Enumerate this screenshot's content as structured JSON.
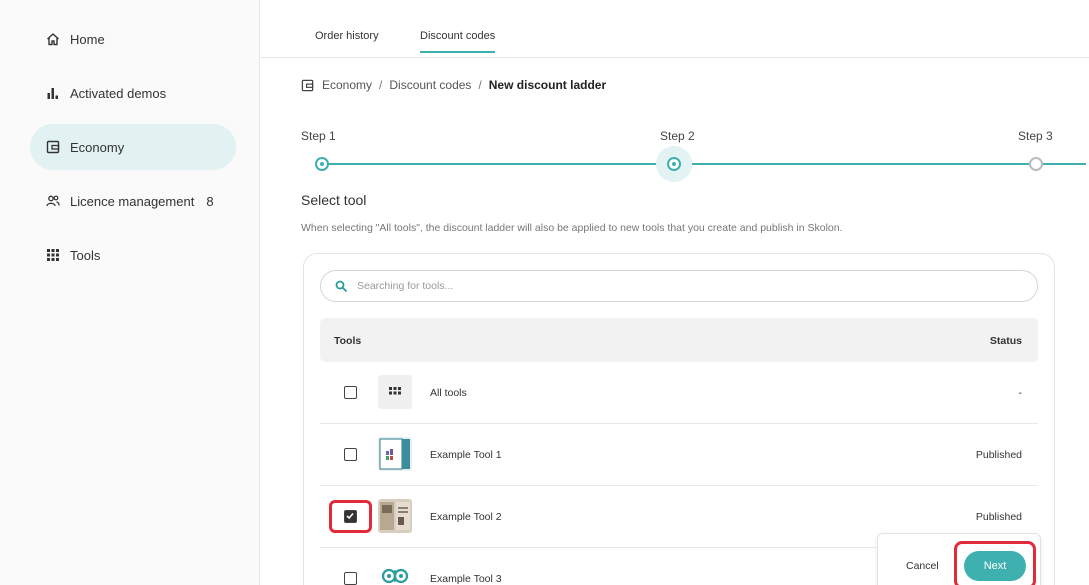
{
  "sidebar": {
    "items": [
      {
        "label": "Home",
        "icon": "home-icon"
      },
      {
        "label": "Activated demos",
        "icon": "bar-chart-icon"
      },
      {
        "label": "Economy",
        "icon": "wallet-icon"
      },
      {
        "label": "Licence management",
        "icon": "users-icon",
        "badge": "8"
      },
      {
        "label": "Tools",
        "icon": "grid-icon"
      }
    ]
  },
  "tabs": [
    {
      "label": "Order history"
    },
    {
      "label": "Discount codes"
    }
  ],
  "breadcrumb": {
    "icon": "wallet-icon",
    "items": [
      "Economy",
      "Discount codes"
    ],
    "separator": "/",
    "current": "New discount ladder"
  },
  "stepper": {
    "steps": [
      {
        "label": "Step 1"
      },
      {
        "label": "Step 2"
      },
      {
        "label": "Step 3"
      }
    ]
  },
  "section": {
    "title": "Select tool",
    "description": "When selecting \"All tools\", the discount ladder will also be applied to new tools that you create and publish in Skolon."
  },
  "search": {
    "placeholder": "Searching for tools...",
    "value": ""
  },
  "table": {
    "headers": {
      "tools": "Tools",
      "status": "Status"
    },
    "rows": [
      {
        "name": "All tools",
        "status": "-",
        "checked": false,
        "thumb": "grid-icon"
      },
      {
        "name": "Example Tool 1",
        "status": "Published",
        "checked": false,
        "thumb": "tool1-thumbnail"
      },
      {
        "name": "Example Tool 2",
        "status": "Published",
        "checked": true,
        "thumb": "tool2-thumbnail"
      },
      {
        "name": "Example Tool 3",
        "status": "",
        "checked": false,
        "thumb": "tool3-logo-icon"
      }
    ]
  },
  "actions": {
    "cancel_label": "Cancel",
    "next_label": "Next"
  },
  "colors": {
    "accent": "#3fb0b0",
    "active_nav": "#e2f2f2",
    "highlight": "#e22b3a"
  }
}
